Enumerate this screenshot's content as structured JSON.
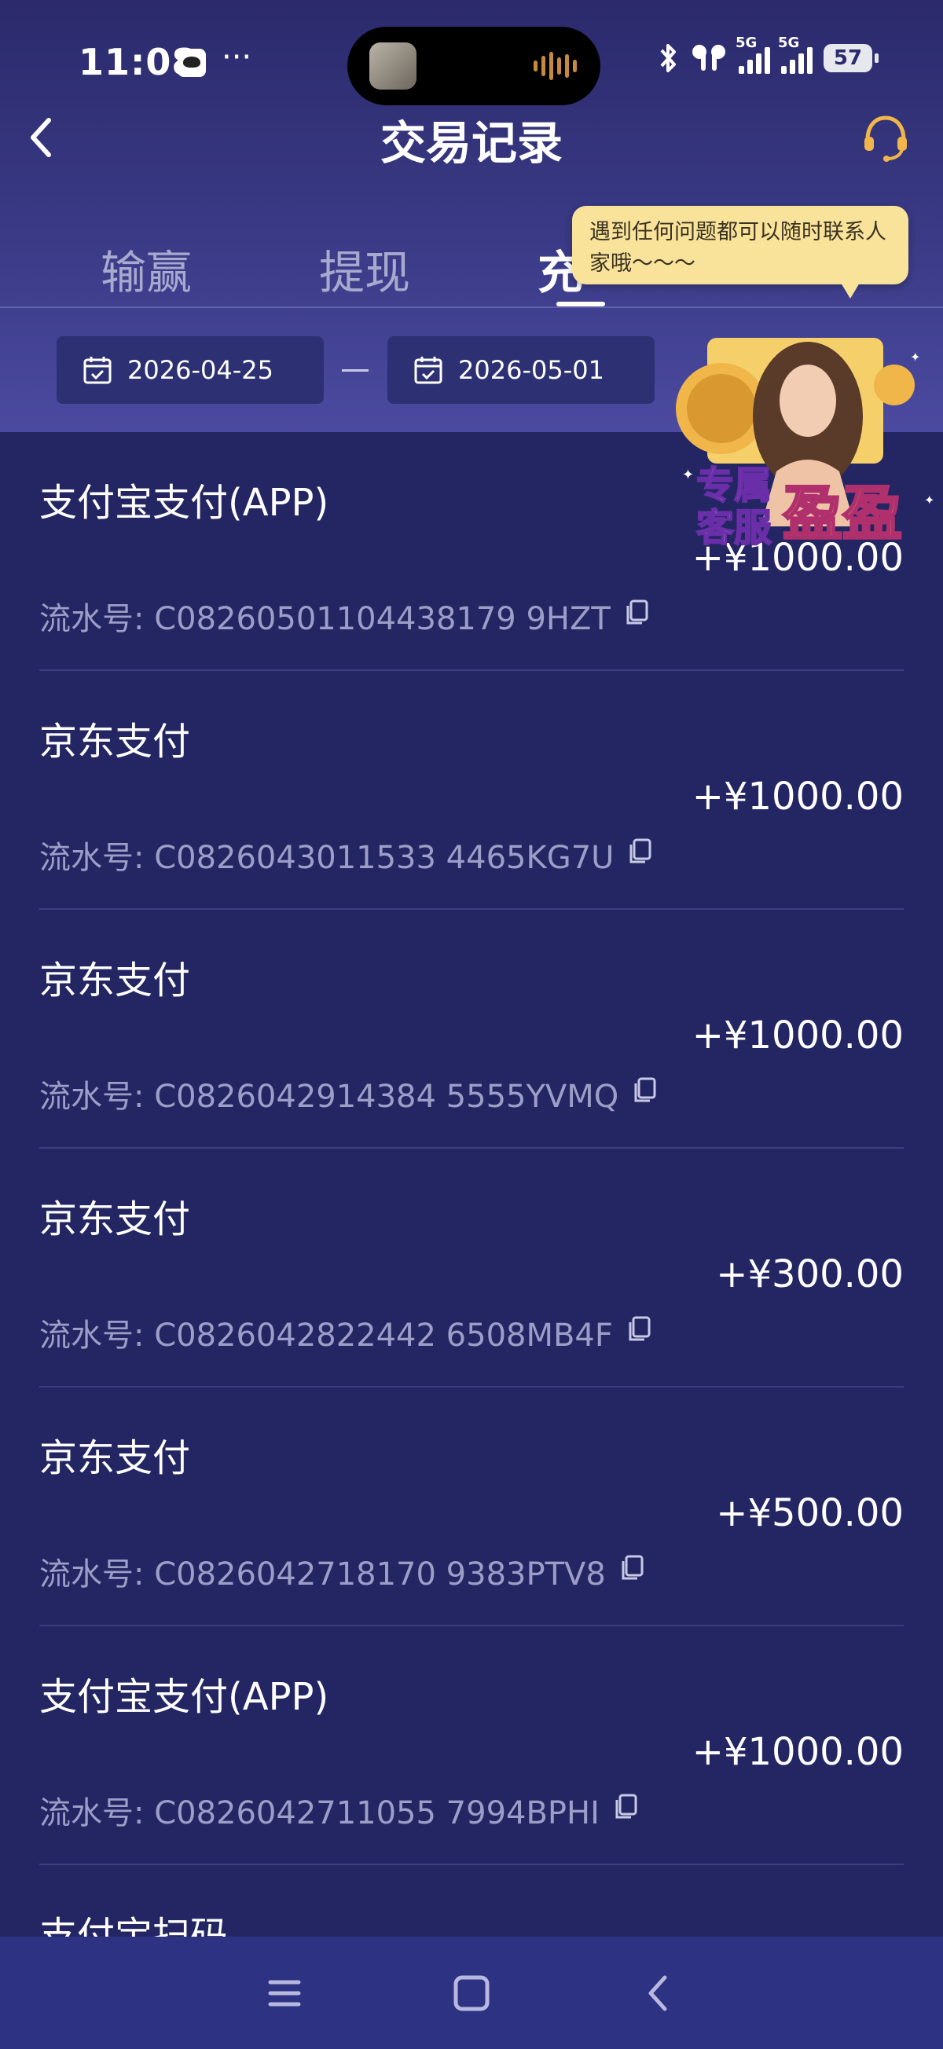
{
  "status_bar": {
    "time": "11:08",
    "more": "···",
    "battery": "57",
    "net1": "5G",
    "net2": "5G"
  },
  "header": {
    "title": "交易记录",
    "back_icon": "chevron-left-icon",
    "support_icon": "headset-icon"
  },
  "tabs": [
    {
      "label": "输赢",
      "active": false
    },
    {
      "label": "提现",
      "active": false
    },
    {
      "label": "充",
      "active": true
    }
  ],
  "tooltip": {
    "text": "遇到任何问题都可以随时联系人家哦～～～"
  },
  "date_range": {
    "start": "2026-04-25",
    "end": "2026-05-01"
  },
  "promo": {
    "line1": "专属",
    "line2": "客服",
    "name": "盈盈"
  },
  "transactions": [
    {
      "method": "支付宝支付(APP)",
      "amount": "+¥1000.00",
      "serial": "流水号: C08260501104438179 9HZT"
    },
    {
      "method": "京东支付",
      "amount": "+¥1000.00",
      "serial": "流水号: C0826043011533 4465KG7U"
    },
    {
      "method": "京东支付",
      "amount": "+¥1000.00",
      "serial": "流水号: C0826042914384 5555YVMQ"
    },
    {
      "method": "京东支付",
      "amount": "+¥300.00",
      "serial": "流水号: C0826042822442 6508MB4F"
    },
    {
      "method": "京东支付",
      "amount": "+¥500.00",
      "serial": "流水号: C0826042718170 9383PTV8"
    },
    {
      "method": "支付宝支付(APP)",
      "amount": "+¥1000.00",
      "serial": "流水号: C0826042711055 7994BPHI"
    },
    {
      "method": "支付宝扫码",
      "amount": "",
      "serial": ""
    }
  ],
  "colors": {
    "background": "#242663",
    "header_top": "#2b2a6c",
    "header_bottom": "#4b4aa0",
    "tooltip": "#f9e39b",
    "accent_gold": "#f1b64a",
    "muted_text": "#9c9ec8"
  }
}
